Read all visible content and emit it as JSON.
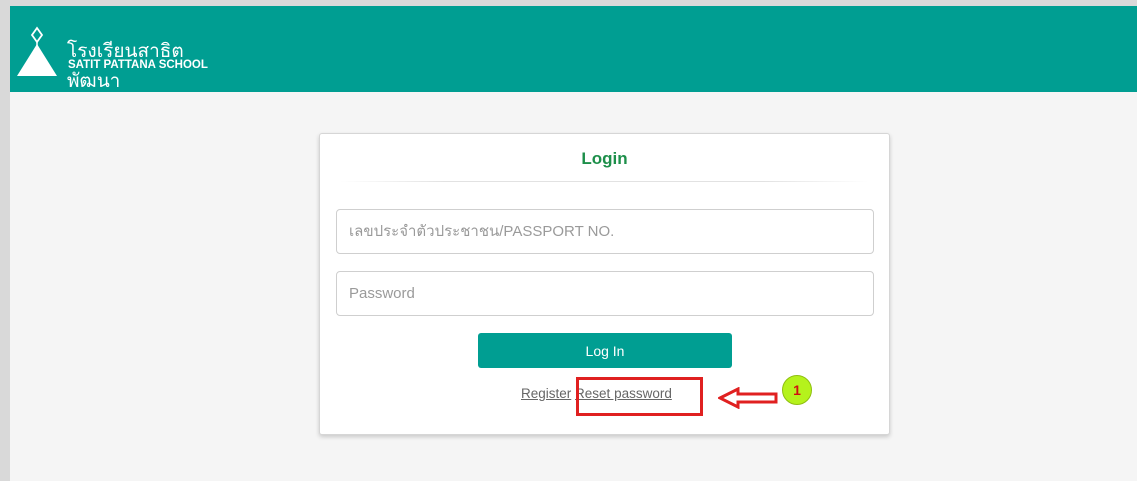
{
  "header": {
    "school_name_th": "โรงเรียนสาธิตพัฒนา",
    "school_name_en": "SATIT PATTANA SCHOOL",
    "brand_color": "#009e92"
  },
  "login": {
    "title": "Login",
    "id_placeholder": "เลขประจำตัวประชาชน/PASSPORT NO.",
    "password_placeholder": "Password",
    "login_button": "Log In",
    "register_link": "Register",
    "reset_link": "Reset password"
  },
  "annotation": {
    "badge_number": "1",
    "highlight_color": "#e02020",
    "badge_color": "#b5f21c"
  }
}
